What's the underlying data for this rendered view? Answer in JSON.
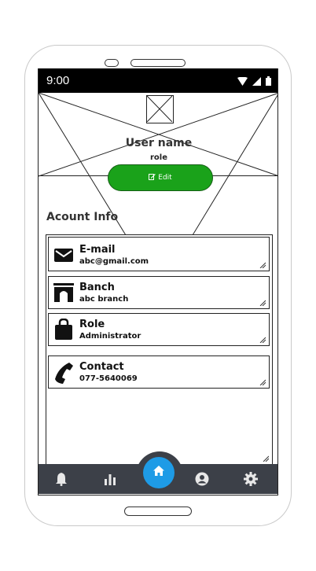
{
  "status_bar": {
    "time": "9:00",
    "icons": [
      "wifi-icon",
      "signal-icon",
      "battery-icon"
    ]
  },
  "profile": {
    "username": "User name",
    "role": "role",
    "edit_label": "Edit",
    "edit_color": "#1aa21a"
  },
  "account_info": {
    "title": "Acount Info",
    "items": [
      {
        "icon": "envelope-icon",
        "label": "E-mail",
        "value": "abc@gmail.com"
      },
      {
        "icon": "bank-icon",
        "label": "Banch",
        "value": "abc branch"
      },
      {
        "icon": "briefcase-icon",
        "label": "Role",
        "value": "Administrator"
      },
      {
        "icon": "phone-icon",
        "label": "Contact",
        "value": "077-5640069"
      }
    ]
  },
  "bottom_nav": {
    "background": "#3c4048",
    "home_color": "#1e9be6",
    "items": [
      "bell-icon",
      "bar-chart-icon",
      "home-icon",
      "account-icon",
      "settings-icon"
    ]
  }
}
